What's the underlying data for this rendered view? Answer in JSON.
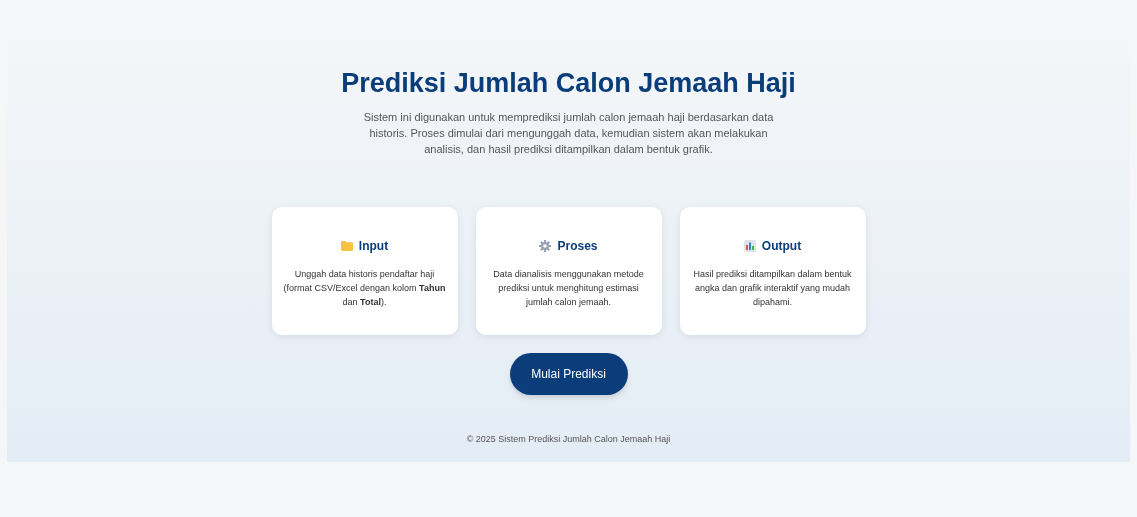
{
  "header": {
    "title": "Prediksi Jumlah Calon Jemaah Haji",
    "description": "Sistem ini digunakan untuk memprediksi jumlah calon jemaah haji berdasarkan data historis. Proses dimulai dari mengunggah data, kemudian sistem akan melakukan analisis, dan hasil prediksi ditampilkan dalam bentuk grafik."
  },
  "cards": [
    {
      "kind": "folder",
      "title": "Input",
      "text": "Unggah data historis pendaftar haji (format CSV/Excel dengan kolom **Tahun** dan **Total**)."
    },
    {
      "kind": "gear",
      "title": "Proses",
      "text": "Data dianalisis menggunakan metode prediksi untuk menghitung estimasi jumlah calon jemaah."
    },
    {
      "kind": "chart",
      "title": "Output",
      "text": "Hasil prediksi ditampilkan dalam bentuk angka dan grafik interaktif yang mudah dipahami."
    }
  ],
  "button": "Mulai Prediksi",
  "footer": "© 2025 Sistem Prediksi Jumlah Calon Jemaah Haji"
}
